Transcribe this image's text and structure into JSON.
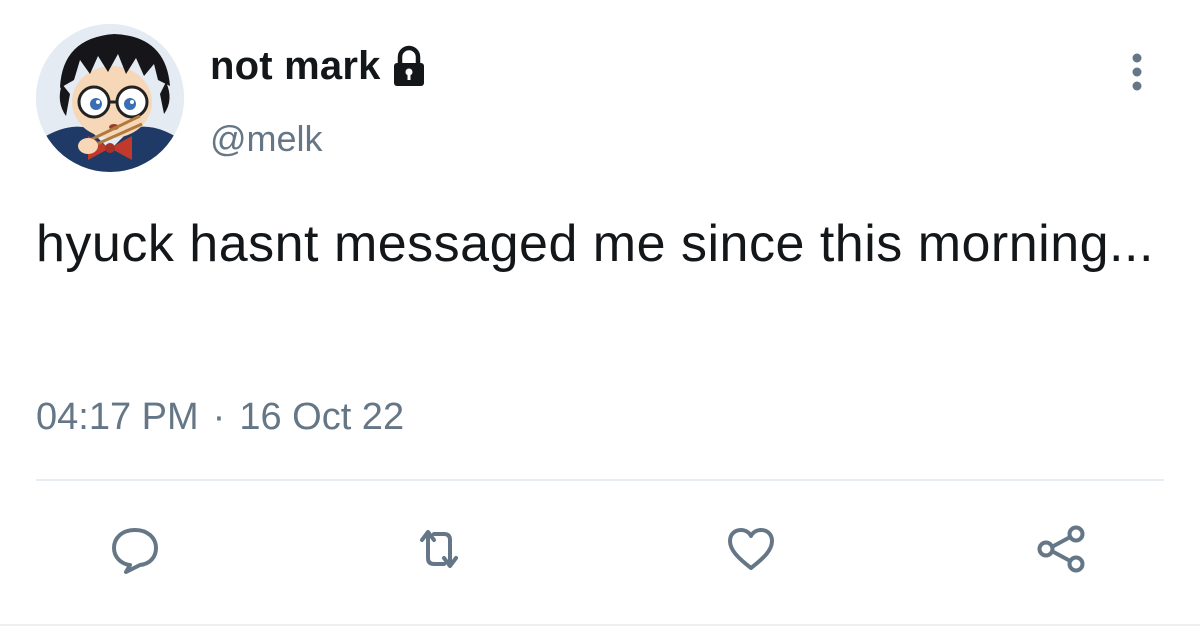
{
  "tweet": {
    "display_name": "not mark",
    "handle": "@melk",
    "text": "hyuck hasnt messaged me since this morning...",
    "time": "04:17 PM",
    "separator": "·",
    "date": "16 Oct 22"
  },
  "icons": {
    "lock": "lock-icon",
    "more": "more-vertical-icon",
    "reply": "reply-icon",
    "retweet": "retweet-icon",
    "like": "heart-icon",
    "share": "share-icon"
  },
  "colors": {
    "text_primary": "#14171a",
    "text_secondary": "#657786",
    "icon": "#657786",
    "divider": "#e6ecf0"
  }
}
